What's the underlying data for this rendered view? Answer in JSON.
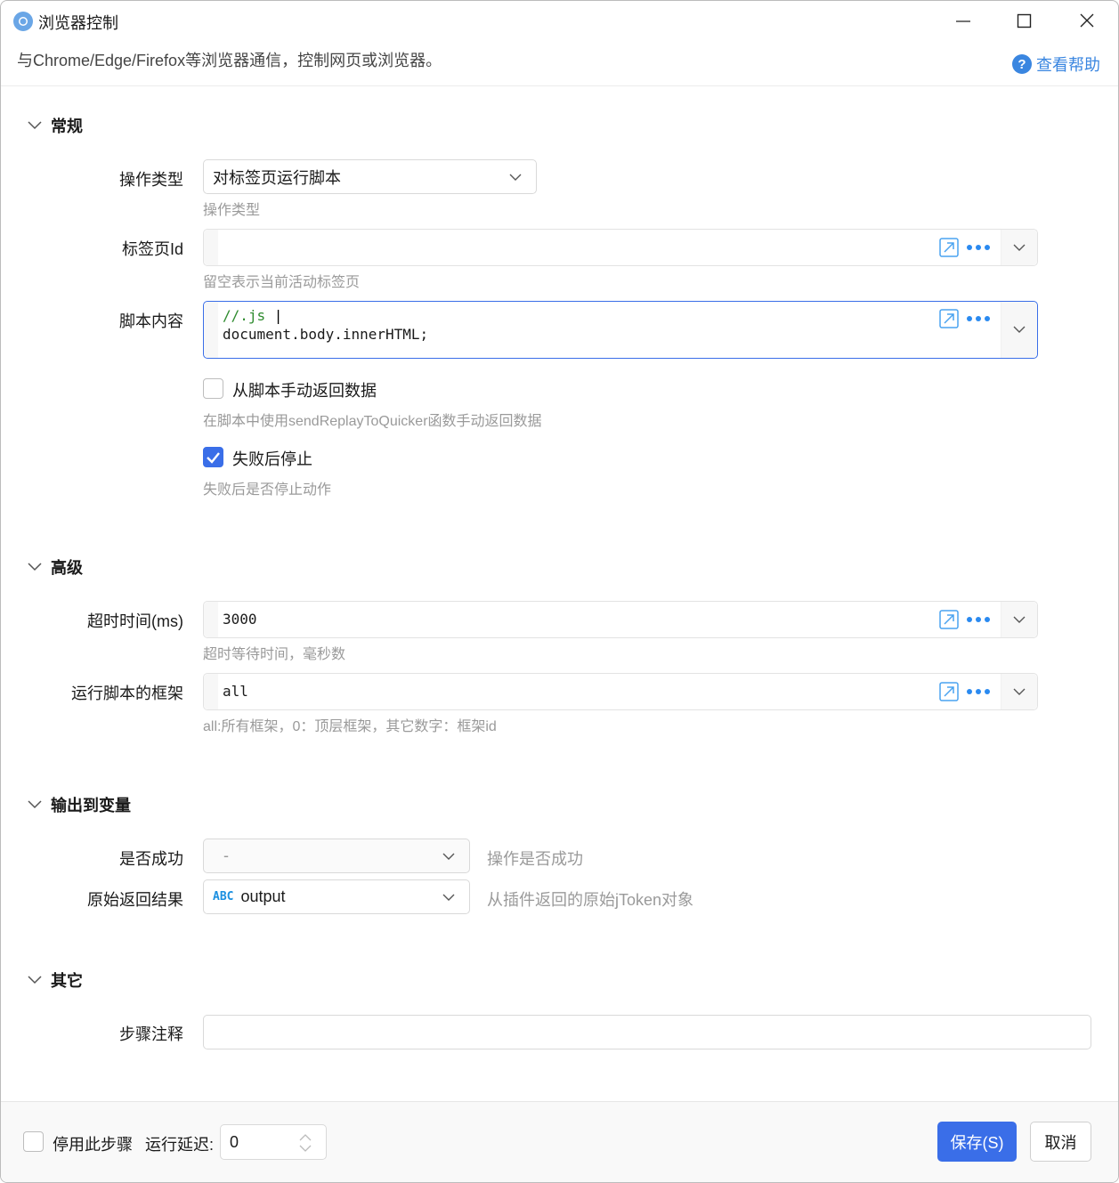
{
  "window": {
    "title": "浏览器控制",
    "description": "与Chrome/Edge/Firefox等浏览器通信，控制网页或浏览器。",
    "help_label": "查看帮助"
  },
  "sections": {
    "general": {
      "title": "常规",
      "op_type": {
        "label": "操作类型",
        "value": "对标签页运行脚本",
        "hint": "操作类型"
      },
      "tab_id": {
        "label": "标签页Id",
        "value": "",
        "hint": "留空表示当前活动标签页"
      },
      "script": {
        "label": "脚本内容",
        "line1": "//.js ",
        "line2": "document.body.innerHTML;"
      },
      "manual_return": {
        "label": "从脚本手动返回数据",
        "checked": false,
        "hint": "在脚本中使用sendReplayToQuicker函数手动返回数据"
      },
      "stop_on_fail": {
        "label": "失败后停止",
        "checked": true,
        "hint": "失败后是否停止动作"
      }
    },
    "advanced": {
      "title": "高级",
      "timeout": {
        "label": "超时时间(ms)",
        "value": "3000",
        "hint": "超时等待时间，毫秒数"
      },
      "frame": {
        "label": "运行脚本的框架",
        "value": "all",
        "hint": "all:所有框架，0：顶层框架，其它数字：框架id"
      }
    },
    "output": {
      "title": "输出到变量",
      "success": {
        "label": "是否成功",
        "value": "-",
        "hint": "操作是否成功"
      },
      "raw": {
        "label": "原始返回结果",
        "type_badge": "ABC",
        "value": "output",
        "hint": "从插件返回的原始jToken对象"
      }
    },
    "other": {
      "title": "其它",
      "note": {
        "label": "步骤注释",
        "value": ""
      }
    }
  },
  "footer": {
    "disable_label": "停用此步骤",
    "disable_checked": false,
    "delay_label": "运行延迟:",
    "delay_value": "0",
    "save_label": "保存(S)",
    "cancel_label": "取消"
  },
  "colors": {
    "accent": "#3a6ee8",
    "link": "#3a86e0",
    "hint": "#9a9a9a",
    "code_comment": "#2e8b2e"
  }
}
